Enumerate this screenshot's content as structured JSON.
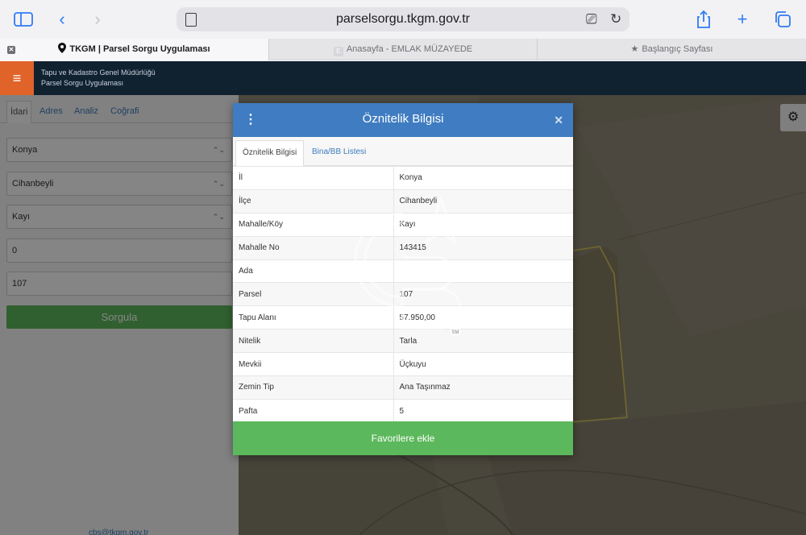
{
  "browser": {
    "url": "parselsorgu.tkgm.gov.tr",
    "tabs": [
      {
        "label": "TKGM | Parsel Sorgu Uygulaması"
      },
      {
        "label": "Anasayfa - EMLAK MÜZAYEDE",
        "favicon": "E"
      },
      {
        "label": "Başlangıç Sayfası"
      }
    ]
  },
  "header": {
    "org": "Tapu ve Kadastro Genel Müdürlüğü",
    "app": "Parsel Sorgu Uygulaması"
  },
  "sidebar": {
    "tabs": [
      "İdari",
      "Adres",
      "Analiz",
      "Coğrafi"
    ],
    "province": "Konya",
    "district": "Cihanbeyli",
    "neighborhood": "Kayı",
    "ada": "0",
    "parsel": "107",
    "query_button": "Sorgula",
    "footer_email": "cbs@tkgm.gov.tr"
  },
  "modal": {
    "title": "Öznitelik Bilgisi",
    "tabs": [
      "Öznitelik Bilgisi",
      "Bina/BB Listesi"
    ],
    "rows": [
      {
        "key": "İl",
        "value": "Konya"
      },
      {
        "key": "İlçe",
        "value": "Cihanbeyli"
      },
      {
        "key": "Mahalle/Köy",
        "value": "Kayı"
      },
      {
        "key": "Mahalle No",
        "value": "143415"
      },
      {
        "key": "Ada",
        "value": ""
      },
      {
        "key": "Parsel",
        "value": "107"
      },
      {
        "key": "Tapu Alanı",
        "value": "57.950,00"
      },
      {
        "key": "Nitelik",
        "value": "Tarla"
      },
      {
        "key": "Mevkii",
        "value": "Üçkuyu"
      },
      {
        "key": "Zemin Tip",
        "value": "Ana Taşınmaz"
      },
      {
        "key": "Pafta",
        "value": "5"
      }
    ],
    "favorite_button": "Favorilere ekle"
  },
  "watermark": {
    "mark": "CB",
    "sub": "SM"
  },
  "colors": {
    "modal_header": "#3f7cc1",
    "success_green": "#5cb85c",
    "app_header": "#102130",
    "menu_orange": "#e0632a",
    "parcel_outline": "#d8c85a"
  }
}
